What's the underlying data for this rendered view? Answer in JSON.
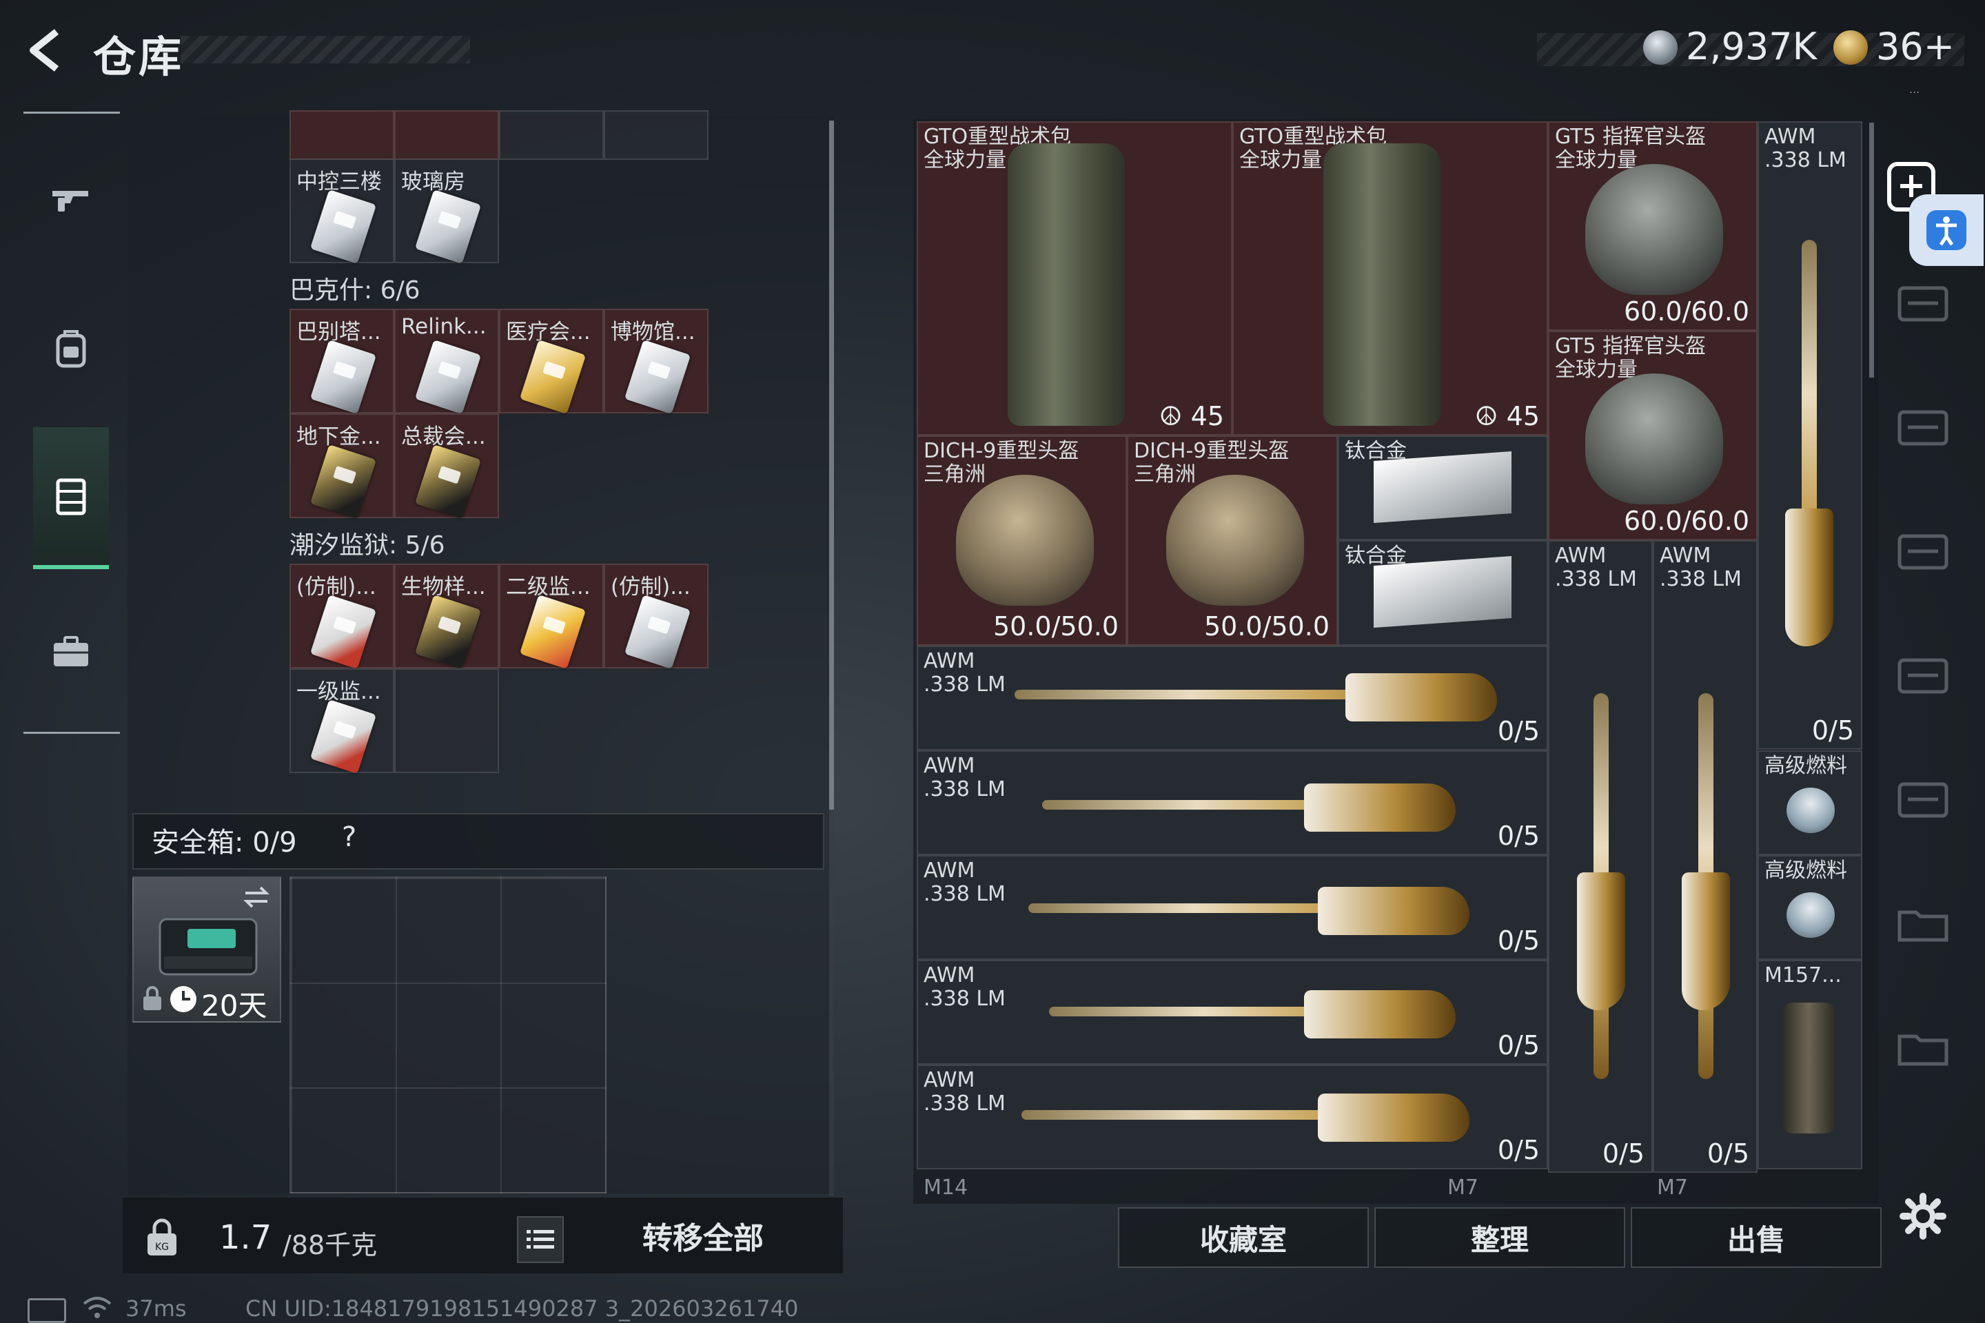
{
  "header": {
    "title": "仓库",
    "money": "2,937K",
    "tokens": "36+",
    "version_hint": "..."
  },
  "left_nav": {
    "items": [
      {
        "name": "weapons",
        "icon": "gun-icon"
      },
      {
        "name": "equipment",
        "icon": "backpack-icon"
      },
      {
        "name": "armory",
        "icon": "locker-icon",
        "active": true
      },
      {
        "name": "briefcase",
        "icon": "briefcase-icon"
      }
    ]
  },
  "key_cards": {
    "row0": [
      {
        "label": ""
      },
      {
        "label": ""
      },
      {
        "label": ""
      },
      {
        "label": ""
      }
    ],
    "group_top": [
      {
        "label": "中控三楼"
      },
      {
        "label": "玻璃房"
      }
    ],
    "section_bakesh": "巴克什: 6/6",
    "bakesh": [
      {
        "label": "巴别塔..."
      },
      {
        "label": "Relink..."
      },
      {
        "label": "医疗会..."
      },
      {
        "label": "博物馆..."
      },
      {
        "label": "地下金..."
      },
      {
        "label": "总裁会..."
      }
    ],
    "section_tide": "潮汐监狱: 5/6",
    "tide": [
      {
        "label": "(仿制)..."
      },
      {
        "label": "生物样..."
      },
      {
        "label": "二级监..."
      },
      {
        "label": "(仿制)..."
      },
      {
        "label": "一级监..."
      }
    ]
  },
  "safe": {
    "label": "安全箱:  0/9",
    "help": "?",
    "days": "20天"
  },
  "bottom_left": {
    "weight": "1.7",
    "weight_unit": "/88千克",
    "transfer_label": "转移全部",
    "status": "37ms",
    "uid": "CN UID:1848179198151490287 3_202603261740"
  },
  "stash": {
    "items": [
      {
        "id": "bag1",
        "name": "GTO重型战术包",
        "sub": "全球力量",
        "stat": "45"
      },
      {
        "id": "bag2",
        "name": "GTO重型战术包",
        "sub": "全球力量",
        "stat": "45"
      },
      {
        "id": "gt5a",
        "name": "GT5 指挥官头盔",
        "sub": "全球力量",
        "stat": "60.0/60.0"
      },
      {
        "id": "gt5b",
        "name": "GT5 指挥官头盔",
        "sub": "全球力量",
        "stat": "60.0/60.0"
      },
      {
        "id": "awm_v1",
        "name": "AWM",
        "sub": ".338 LM",
        "stat": "0/5"
      },
      {
        "id": "dich1",
        "name": "DICH-9重型头盔",
        "sub": "三角洲",
        "stat": "50.0/50.0"
      },
      {
        "id": "dich2",
        "name": "DICH-9重型头盔",
        "sub": "三角洲",
        "stat": "50.0/50.0"
      },
      {
        "id": "ti1",
        "name": "钛合金",
        "sub": "",
        "stat": ""
      },
      {
        "id": "ti2",
        "name": "钛合金",
        "sub": "",
        "stat": ""
      },
      {
        "id": "awm_v2",
        "name": "AWM",
        "sub": ".338 LM",
        "stat": "0/5"
      },
      {
        "id": "awm_v3",
        "name": "AWM",
        "sub": ".338 LM",
        "stat": "0/5"
      },
      {
        "id": "awm_h1",
        "name": "AWM",
        "sub": ".338 LM",
        "stat": "0/5"
      },
      {
        "id": "awm_h2",
        "name": "AWM",
        "sub": ".338 LM",
        "stat": "0/5"
      },
      {
        "id": "awm_h3",
        "name": "AWM",
        "sub": ".338 LM",
        "stat": "0/5"
      },
      {
        "id": "awm_h4",
        "name": "AWM",
        "sub": ".338 LM",
        "stat": "0/5"
      },
      {
        "id": "awm_h5",
        "name": "AWM",
        "sub": ".338 LM",
        "stat": "0/5"
      },
      {
        "id": "fuel1",
        "name": "高级燃料",
        "sub": "",
        "stat": ""
      },
      {
        "id": "fuel2",
        "name": "高级燃料",
        "sub": "",
        "stat": ""
      },
      {
        "id": "m157",
        "name": "M157...",
        "sub": "",
        "stat": ""
      }
    ],
    "bottom_labels": [
      "M14",
      "M7",
      "M7"
    ]
  },
  "actions": {
    "collection": "收藏室",
    "sort": "整理",
    "sell": "出售"
  },
  "colors": {
    "accent": "#5ad2a0",
    "item_red": "#3d2325",
    "item_dark": "#262b31"
  }
}
